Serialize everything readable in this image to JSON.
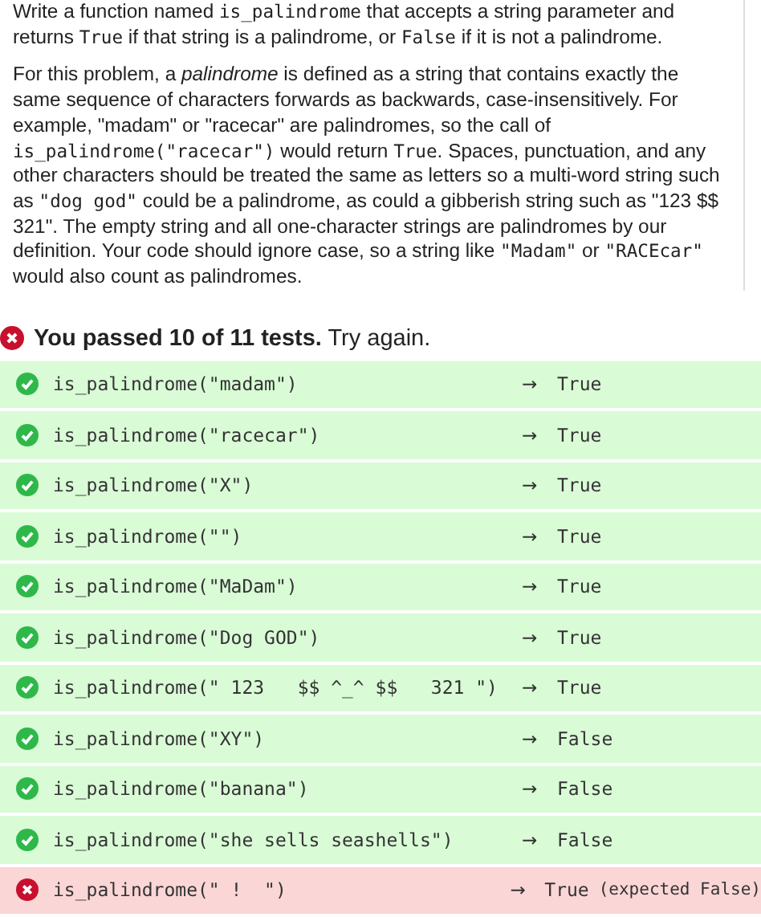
{
  "description": [
    [
      {
        "kind": "plain",
        "text": "Write a function named "
      },
      {
        "kind": "code",
        "text": "is_palindrome"
      },
      {
        "kind": "plain",
        "text": " that accepts a string parameter and returns "
      },
      {
        "kind": "code",
        "text": "True"
      },
      {
        "kind": "plain",
        "text": " if that string is a palindrome, or "
      },
      {
        "kind": "code",
        "text": "False"
      },
      {
        "kind": "plain",
        "text": " if it is not a palindrome."
      }
    ],
    [
      {
        "kind": "plain",
        "text": "For this problem, a "
      },
      {
        "kind": "em",
        "text": "palindrome"
      },
      {
        "kind": "plain",
        "text": " is defined as a string that contains exactly the same sequence of characters forwards as backwards, case-insensitively. For example, \"madam\" or \"racecar\" are palindromes, so the call of "
      },
      {
        "kind": "code",
        "text": "is_palindrome(\"racecar\")"
      },
      {
        "kind": "plain",
        "text": " would return "
      },
      {
        "kind": "code",
        "text": "True"
      },
      {
        "kind": "plain",
        "text": ". Spaces, punctuation, and any other characters should be treated the same as letters so a multi-word string such as "
      },
      {
        "kind": "code",
        "text": "\"dog god\""
      },
      {
        "kind": "plain",
        "text": " could be a palindrome, as could a gibberish string such as \"123 $$ 321\". The empty string and all one-character strings are palindromes by our definition. Your code should ignore case, so a string like "
      },
      {
        "kind": "code",
        "text": "\"Madam\""
      },
      {
        "kind": "plain",
        "text": " or "
      },
      {
        "kind": "code",
        "text": "\"RACEcar\""
      },
      {
        "kind": "plain",
        "text": " would also count as palindromes."
      }
    ]
  ],
  "summary": {
    "passed": false,
    "count_text": "You passed 10 of 11 tests.",
    "message": "Try again."
  },
  "tests": [
    {
      "passed": true,
      "call": "is_palindrome(\"madam\")",
      "arrow": "→",
      "result": "True"
    },
    {
      "passed": true,
      "call": "is_palindrome(\"racecar\")",
      "arrow": "→",
      "result": "True"
    },
    {
      "passed": true,
      "call": "is_palindrome(\"X\")",
      "arrow": "→",
      "result": "True"
    },
    {
      "passed": true,
      "call": "is_palindrome(\"\")",
      "arrow": "→",
      "result": "True"
    },
    {
      "passed": true,
      "call": "is_palindrome(\"MaDam\")",
      "arrow": "→",
      "result": "True"
    },
    {
      "passed": true,
      "call": "is_palindrome(\"Dog GOD\")",
      "arrow": "→",
      "result": "True"
    },
    {
      "passed": true,
      "call": "is_palindrome(\" 123   $$ ^_^ $$   321 \")",
      "arrow": "→",
      "result": "True"
    },
    {
      "passed": true,
      "call": "is_palindrome(\"XY\")",
      "arrow": "→",
      "result": "False"
    },
    {
      "passed": true,
      "call": "is_palindrome(\"banana\")",
      "arrow": "→",
      "result": "False"
    },
    {
      "passed": true,
      "call": "is_palindrome(\"she sells seashells\")",
      "arrow": "→",
      "result": "False"
    },
    {
      "passed": false,
      "call": "is_palindrome(\" !  \")",
      "arrow": "→",
      "result": "True",
      "expected": "(expected False)"
    }
  ]
}
